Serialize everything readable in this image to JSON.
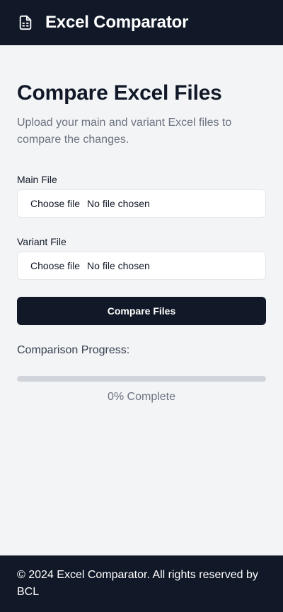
{
  "header": {
    "logo_icon": "file-spreadsheet-icon",
    "title": "Excel Comparator"
  },
  "main": {
    "heading": "Compare Excel Files",
    "subtitle": "Upload your main and variant Excel files to compare the changes.",
    "main_file": {
      "label": "Main File",
      "button": "Choose file",
      "status": "No file chosen"
    },
    "variant_file": {
      "label": "Variant File",
      "button": "Choose file",
      "status": "No file chosen"
    },
    "compare_button": "Compare Files",
    "progress": {
      "label": "Comparison Progress:",
      "value_percent": 0,
      "text": "0% Complete"
    }
  },
  "footer": {
    "text": "© 2024 Excel Comparator. All rights reserved by  BCL"
  },
  "colors": {
    "header_bg": "#111827",
    "page_bg": "#f3f4f6",
    "button_bg": "#111827",
    "progress_track": "#d1d5db",
    "muted_text": "#6b7280"
  }
}
